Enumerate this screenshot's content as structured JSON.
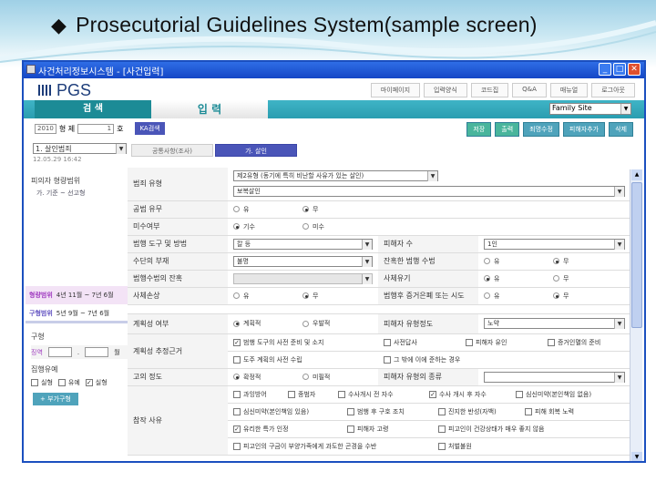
{
  "slide_title": "Prosecutorial Guidelines System(sample screen)",
  "window": {
    "title": "사건처리정보시스템 - [사건입력]"
  },
  "logo": "PGS",
  "top_links": [
    "마이페이지",
    "입력양식",
    "코드집",
    "Q&A",
    "매뉴얼",
    "로그아웃"
  ],
  "nav": {
    "tab_search": "검 색",
    "tab_input": "입 력",
    "family_site": "Family Site"
  },
  "case": {
    "year": "2010",
    "type_label": "형 제",
    "number": "1",
    "suffix": "호",
    "ka_search": "KA검색"
  },
  "actions": [
    "저장",
    "출력",
    "죄명수정",
    "피해자추가",
    "삭제"
  ],
  "sidebar": {
    "crime_select": "1. 살인범죄",
    "date": "12.05.29 16:42",
    "victim_header": "피의자 형량범위",
    "victim_sub": "가. 기준 ~ 선고형",
    "range1_label": "형량범위",
    "range1_value": "4년 11월 ~ 7년 6월",
    "range2_label": "구형범위",
    "range2_value": "5년 9월 ~ 7년 6월",
    "sentence_header": "구형",
    "sentence_label": "징역",
    "sentence_sep": ".",
    "sentence_unit": "월",
    "execution_header": "집행유예",
    "execution_opts": [
      {
        "label": "실형",
        "checked": false
      },
      {
        "label": "유예",
        "checked": false
      },
      {
        "label": "실형",
        "checked": true
      }
    ],
    "add_button": "+ 부가구형"
  },
  "content_tabs": [
    "공통사항(조사)",
    "가. 살인"
  ],
  "form": {
    "crime_type": {
      "label": "범죄 유형",
      "value1": "제2유형 (동기에 특히 비난할 사유가 있는 살인)",
      "value2": "보복살인"
    },
    "accomplice": {
      "label": "공범 유무",
      "opts": [
        {
          "l": "유",
          "on": false
        },
        {
          "l": "무",
          "on": true
        }
      ]
    },
    "attempt": {
      "label": "미수여부",
      "opts": [
        {
          "l": "기수",
          "on": true
        },
        {
          "l": "미수",
          "on": false
        }
      ]
    },
    "tool": {
      "label": "범행 도구 및 방법",
      "value": "칼 등",
      "label2": "피해자 수",
      "value2": "1인"
    },
    "means": {
      "label": "수단의 부재",
      "value": "불명",
      "label2": "잔혹한 범행 수법",
      "opts": [
        {
          "l": "유",
          "on": false
        },
        {
          "l": "무",
          "on": true
        }
      ]
    },
    "method": {
      "label": "범행수법의 잔혹",
      "value": "",
      "label2": "사체유기",
      "opts": [
        {
          "l": "유",
          "on": true
        },
        {
          "l": "무",
          "on": false
        }
      ]
    },
    "corpse": {
      "label": "사체손상",
      "opts": [
        {
          "l": "유",
          "on": false
        },
        {
          "l": "무",
          "on": true
        }
      ],
      "label2": "범행후 증거은폐 또는 시도",
      "opts2": [
        {
          "l": "유",
          "on": false
        },
        {
          "l": "무",
          "on": true
        }
      ]
    },
    "plan": {
      "label": "계획성 여부",
      "opts": [
        {
          "l": "계획적",
          "on": true
        },
        {
          "l": "우발적",
          "on": false
        }
      ],
      "label2": "피해자 유형정도",
      "value2": "노약"
    },
    "plan_basis": {
      "label": "계획성 추정근거",
      "row1": [
        {
          "l": "범행 도구의 사전 준비 및 소지",
          "on": true
        },
        {
          "l": "사전답사",
          "on": false
        },
        {
          "l": "피해자 유인",
          "on": false
        },
        {
          "l": "증거인멸의 준비",
          "on": false
        }
      ],
      "row2": [
        {
          "l": "도주 계획의 사전 수립",
          "on": false
        },
        {
          "l": "그 밖에 이에 준하는 경우",
          "on": false
        }
      ]
    },
    "intent": {
      "label": "고의 정도",
      "opts": [
        {
          "l": "확정적",
          "on": true
        },
        {
          "l": "미필적",
          "on": false
        }
      ],
      "label2": "피해자 유형의 종류",
      "value2": ""
    },
    "mitigation": {
      "label": "참작 사유",
      "rows": [
        [
          {
            "l": "과잉방어",
            "on": false
          },
          {
            "l": "종범자",
            "on": false
          },
          {
            "l": "수사개시 전 자수",
            "on": false
          },
          {
            "l": "수사 개시 후 자수",
            "on": true
          },
          {
            "l": "심신미약(본인책임 없음)",
            "on": false
          }
        ],
        [
          {
            "l": "심신미약(본인책임 있음)",
            "on": false
          },
          {
            "l": "범행 후 구호 조치",
            "on": false
          },
          {
            "l": "진지한 반성(자백)",
            "on": false
          },
          {
            "l": "피해 회복 노력",
            "on": false
          }
        ],
        [
          {
            "l": "유리한 특가 인정",
            "on": true
          },
          {
            "l": "피해자 고령",
            "on": false
          },
          {
            "l": "피고인이 건강상태가 매우 좋지 않음",
            "on": false
          }
        ],
        [
          {
            "l": "피고인의 구금이 부양가족에게 과도한 곤경을 수반",
            "on": false
          },
          {
            "l": "처벌불원",
            "on": false
          }
        ]
      ]
    }
  }
}
